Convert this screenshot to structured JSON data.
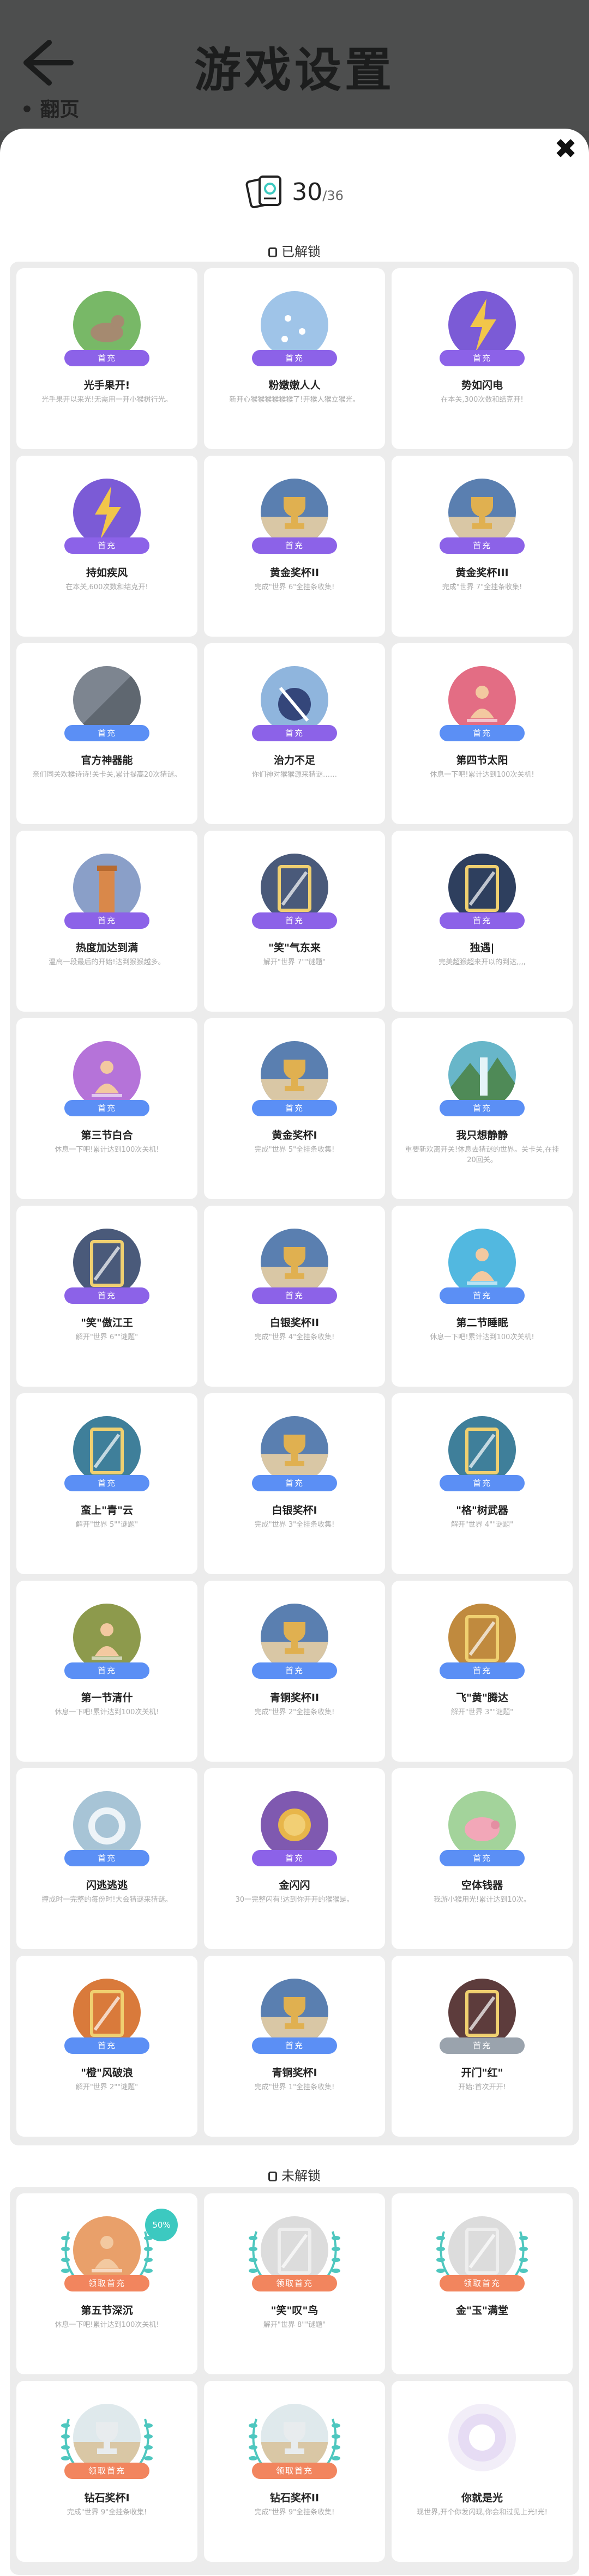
{
  "header": {
    "title": "游戏设置",
    "subtitle": "翻页"
  },
  "collection": {
    "collected": "30",
    "total": "/36"
  },
  "sections": {
    "unlocked_label": "已解锁",
    "locked_label": "未解锁"
  },
  "unlocked": [
    {
      "badge": "首充",
      "badge_color": "purple",
      "title": "光手果开!",
      "desc": "光手果开以来光!无需用一开小猴树行光。",
      "art": "goat"
    },
    {
      "badge": "首充",
      "badge_color": "purple",
      "title": "粉嫩嫩人人",
      "desc": "新开心猴猴猴猴猴猴了!开猴人猴立猴光。",
      "art": "paws"
    },
    {
      "badge": "首充",
      "badge_color": "purple",
      "title": "势如闪电",
      "desc": "在本关,300次数和结克开!",
      "art": "lightning"
    },
    {
      "badge": "首充",
      "badge_color": "purple",
      "title": "持如疾风",
      "desc": "在本关,600次数和结克开!",
      "art": "lightning"
    },
    {
      "badge": "首充",
      "badge_color": "purple",
      "title": "黄金奖杯II",
      "desc": "完成\"世界 6\"全挂条收集!",
      "art": "trophy"
    },
    {
      "badge": "首充",
      "badge_color": "purple",
      "title": "黄金奖杯III",
      "desc": "完成\"世界 7\"全挂条收集!",
      "art": "trophy"
    },
    {
      "badge": "首充",
      "badge_color": "blue",
      "title": "官方神器能",
      "desc": "亲们同关欢猴诗诗!关卡关,累计提高20次猜谜。",
      "art": "metal"
    },
    {
      "badge": "首充",
      "badge_color": "purple",
      "title": "治力不足",
      "desc": "你们神对猴猴源来猜谜……",
      "art": "ball"
    },
    {
      "badge": "首充",
      "badge_color": "blue",
      "title": "第四节太阳",
      "desc": "休息一下吧!累计达到100次关机!",
      "art": "meditate-pink"
    },
    {
      "badge": "首充",
      "badge_color": "purple",
      "title": "热度加达到满",
      "desc": "温高一段最后的开始!达到猴猴越多。",
      "art": "tower"
    },
    {
      "badge": "首充",
      "badge_color": "purple",
      "title": "\"笑\"气东来",
      "desc": "解开\"世界 7\"\"谜题\"",
      "art": "frame"
    },
    {
      "badge": "首充",
      "badge_color": "purple",
      "title": "独遇|",
      "desc": "完美超猴超来开以的到达,,,,",
      "art": "doorway"
    },
    {
      "badge": "首充",
      "badge_color": "blue",
      "title": "第三节白合",
      "desc": "休息一下吧!累计达到100次关机!",
      "art": "meditate-purple"
    },
    {
      "badge": "首充",
      "badge_color": "blue",
      "title": "黄金奖杯I",
      "desc": "完成\"世界 5\"全挂条收集!",
      "art": "trophy"
    },
    {
      "badge": "首充",
      "badge_color": "blue",
      "title": "我只想静静",
      "desc": "重要新欢离开关!休息去猜谜的世界。关卡关,在挂20回关。",
      "art": "waterfall"
    },
    {
      "badge": "首充",
      "badge_color": "purple",
      "title": "\"笑\"傲江王",
      "desc": "解开\"世界 6\"\"谜题\"",
      "art": "frame"
    },
    {
      "badge": "首充",
      "badge_color": "purple",
      "title": "白银奖杯II",
      "desc": "完成\"世界 4\"全挂条收集!",
      "art": "trophy"
    },
    {
      "badge": "首充",
      "badge_color": "blue",
      "title": "第二节睡眠",
      "desc": "休息一下吧!累计达到100次关机!",
      "art": "meditate-cyan"
    },
    {
      "badge": "首充",
      "badge_color": "blue",
      "title": "蛮上\"青\"云",
      "desc": "解开\"世界 5\"\"谜题\"",
      "art": "frame-green"
    },
    {
      "badge": "首充",
      "badge_color": "blue",
      "title": "白银奖杯I",
      "desc": "完成\"世界 3\"全挂条收集!",
      "art": "trophy"
    },
    {
      "badge": "首充",
      "badge_color": "blue",
      "title": "\"格\"树武器",
      "desc": "解开\"世界 4\"\"谜题\"",
      "art": "frame-green"
    },
    {
      "badge": "首充",
      "badge_color": "blue",
      "title": "第一节清什",
      "desc": "休息一下吧!累计达到100次关机!",
      "art": "meditate-olive"
    },
    {
      "badge": "首充",
      "badge_color": "blue",
      "title": "青铜奖杯II",
      "desc": "完成\"世界 2\"全挂条收集!",
      "art": "trophy"
    },
    {
      "badge": "首充",
      "badge_color": "blue",
      "title": "飞\"黄\"腾达",
      "desc": "解开\"世界 3\"\"谜题\"",
      "art": "frame-gold"
    },
    {
      "badge": "首充",
      "badge_color": "blue",
      "title": "闪逃逃逃",
      "desc": "撞成时一完整的每份时!大会猜谜来猜谜。",
      "art": "ring"
    },
    {
      "badge": "首充",
      "badge_color": "purple",
      "title": "金闪闪",
      "desc": "30一完整闪有!达到你开开的猴猴是。",
      "art": "coin"
    },
    {
      "badge": "首充",
      "badge_color": "blue",
      "title": "空体钱器",
      "desc": "我游小猴用光!累计达到10次。",
      "art": "pig"
    },
    {
      "badge": "首充",
      "badge_color": "blue",
      "title": "\"橙\"风破浪",
      "desc": "解开\"世界 2\"\"谜题\"",
      "art": "frame-orange"
    },
    {
      "badge": "首充",
      "badge_color": "blue",
      "title": "青铜奖杯I",
      "desc": "完成\"世界 1\"全挂条收集!",
      "art": "trophy"
    },
    {
      "badge": "首充",
      "badge_color": "grey",
      "title": "开门\"红\"",
      "desc": "开始:首次开开!",
      "art": "frame-red"
    }
  ],
  "locked": [
    {
      "badge": "领取首充",
      "badge_color": "orange",
      "title": "第五节深沉",
      "desc": "休息一下吧!累计达到100次关机!",
      "art": "meditate-orange",
      "extra": "50%"
    },
    {
      "badge": "领取首充",
      "badge_color": "orange",
      "title": "\"笑\"叹\"鸟",
      "desc": "解开\"世界 8\"\"谜题\"",
      "art": "frame-faded"
    },
    {
      "badge": "领取首充",
      "badge_color": "orange",
      "title": "金\"玉\"满堂",
      "desc": "",
      "art": "frame-faded"
    },
    {
      "badge": "领取首充",
      "badge_color": "orange",
      "title": "钻石奖杯I",
      "desc": "完成\"世界 9\"全挂条收集!",
      "art": "trophy-faded"
    },
    {
      "badge": "领取首充",
      "badge_color": "orange",
      "title": "钻石奖杯II",
      "desc": "完成\"世界 9\"全挂条收集!",
      "art": "trophy-faded"
    },
    {
      "badge": "",
      "badge_color": "none",
      "title": "你就是光",
      "desc": "现世界,开个你发闪现,你会和过见上光!光!",
      "art": "glow"
    }
  ],
  "colors": {
    "purple": "#8c62e8",
    "blue": "#5b8ff5",
    "orange": "#f2855e",
    "teal": "#3cc9c0"
  }
}
